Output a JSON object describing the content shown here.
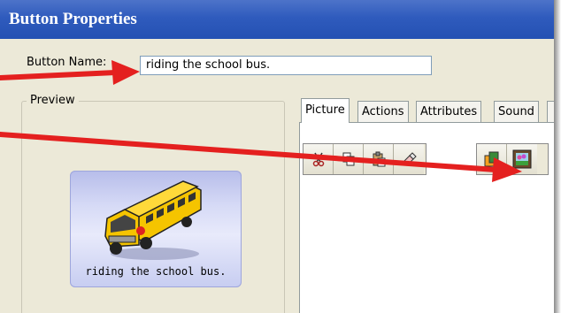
{
  "window": {
    "title": "Button Properties"
  },
  "button_name": {
    "label": "Button Name:",
    "value": "riding the school bus."
  },
  "preview": {
    "legend": "Preview",
    "caption": "riding the school bus."
  },
  "tabs": [
    {
      "label": "Picture",
      "active": true
    },
    {
      "label": "Actions"
    },
    {
      "label": "Attributes"
    },
    {
      "label": "Sound"
    }
  ],
  "toolbar": {
    "left_group": [
      "scissors-icon",
      "copy-icon",
      "paste-icon",
      "eraser-icon"
    ],
    "right_group": [
      "layers-icon",
      "picture-frame-icon"
    ]
  },
  "colors": {
    "titlebar": "#2f5bbd",
    "arrow": "#e4201f",
    "preview_bg": "#d6daf6"
  }
}
